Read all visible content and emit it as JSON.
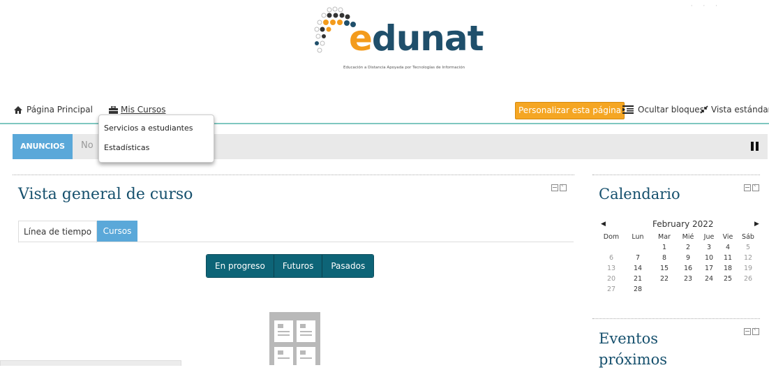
{
  "header": {
    "logo_word": "edunat",
    "logo_tagline": "Educación a Distancia Apoyada por Tecnologías de Información",
    "top_right_text": "·  ·  ·"
  },
  "nav": {
    "home_label": "Página Principal",
    "my_courses_label": "Mis Cursos",
    "customize_label": "Personalizar esta página",
    "hide_blocks_label": "Ocultar bloques",
    "standard_view_label": "Vista estándar"
  },
  "dropdown": {
    "items": [
      "Servicios a estudiantes",
      "Estadísticas"
    ]
  },
  "announcements": {
    "tag": "ANUNCIOS",
    "text": "No"
  },
  "course_overview": {
    "title": "Vista general de curso",
    "tabs": [
      "Línea de tiempo",
      "Cursos"
    ],
    "active_tab": "Cursos",
    "filters": [
      "En progreso",
      "Futuros",
      "Pasados"
    ]
  },
  "calendar": {
    "title": "Calendario",
    "month": "February 2022",
    "day_headers": [
      "Dom",
      "Lun",
      "Mar",
      "Mié",
      "Jue",
      "Vie",
      "Sáb"
    ],
    "weeks": [
      [
        "",
        "",
        "1",
        "2",
        "3",
        "4",
        "5"
      ],
      [
        "6",
        "7",
        "8",
        "9",
        "10",
        "11",
        "12"
      ],
      [
        "13",
        "14",
        "15",
        "16",
        "17",
        "18",
        "19"
      ],
      [
        "20",
        "21",
        "22",
        "23",
        "24",
        "25",
        "26"
      ],
      [
        "27",
        "28",
        "",
        "",
        "",
        "",
        ""
      ]
    ]
  },
  "upcoming_events": {
    "title": "Eventos próximos"
  },
  "colors": {
    "accent_teal": "#0d6477",
    "tab_blue": "#5aa8d9",
    "customize_orange": "#f5a623",
    "heading_blue": "#16506d",
    "nav_line": "#7fc7c0"
  }
}
